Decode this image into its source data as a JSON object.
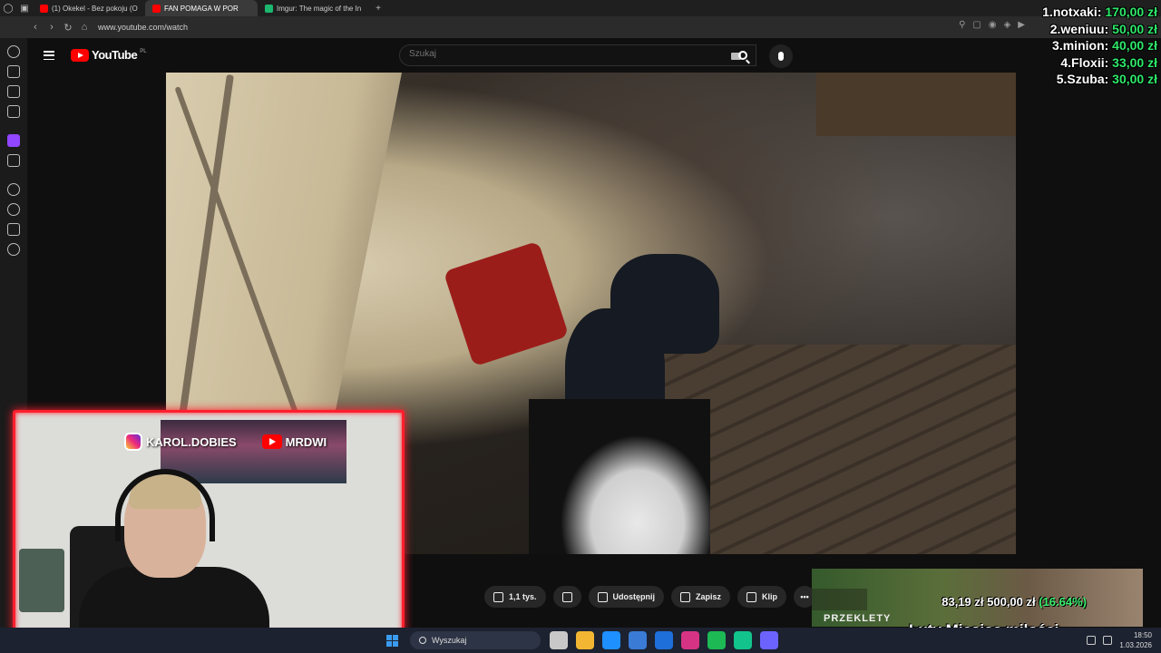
{
  "browser": {
    "tabs": [
      {
        "title": "(1) Okekel - Bez pokoju (O",
        "active": false,
        "favicon_color": "#ff0000"
      },
      {
        "title": "FAN POMAGA W POR",
        "active": true,
        "favicon_color": "#ff0000"
      },
      {
        "title": "Imgur: The magic of the In",
        "active": false,
        "favicon_color": "#1bb76e"
      }
    ],
    "url": "www.youtube.com/watch"
  },
  "youtube": {
    "logo_text": "YouTube",
    "region": "PL",
    "search_placeholder": "Szukaj"
  },
  "actions": {
    "likes": "1,1 tys.",
    "share": "Udostępnij",
    "save": "Zapisz",
    "clip": "Klip"
  },
  "webcam": {
    "instagram_handle": "KAROL.DOBIES",
    "youtube_handle": "MRDWI"
  },
  "leaderboard": [
    {
      "rank": "1.",
      "name": "notxaki:",
      "amount": "170,00 zł"
    },
    {
      "rank": "2.",
      "name": "weniuu:",
      "amount": "50,00 zł"
    },
    {
      "rank": "3.",
      "name": "minion:",
      "amount": "40,00 zł"
    },
    {
      "rank": "4.",
      "name": "Floxii:",
      "amount": "33,00 zł"
    },
    {
      "rank": "5.",
      "name": "Szuba:",
      "amount": "30,00 zł"
    }
  ],
  "goal": {
    "current": "83,19 zł",
    "target": "500,00 zł",
    "percent_label": "(16.64%)",
    "percent": 16.64,
    "label": "Luty Miesiąc miłości",
    "tag": "PRZEKLETY"
  },
  "taskbar": {
    "search_label": "Wyszukaj",
    "time": "18:50",
    "date": "1.03.2026",
    "apps": [
      "#c8c8c8",
      "#f2b632",
      "#1e90ff",
      "#3a7bd5",
      "#1e6fd9",
      "#d63384",
      "#1db954",
      "#12c48b",
      "#6c63ff"
    ]
  },
  "colors": {
    "cam_border": "#ff1f2e",
    "leader_amount": "#2ee86a",
    "youtube_red": "#ff0000"
  }
}
